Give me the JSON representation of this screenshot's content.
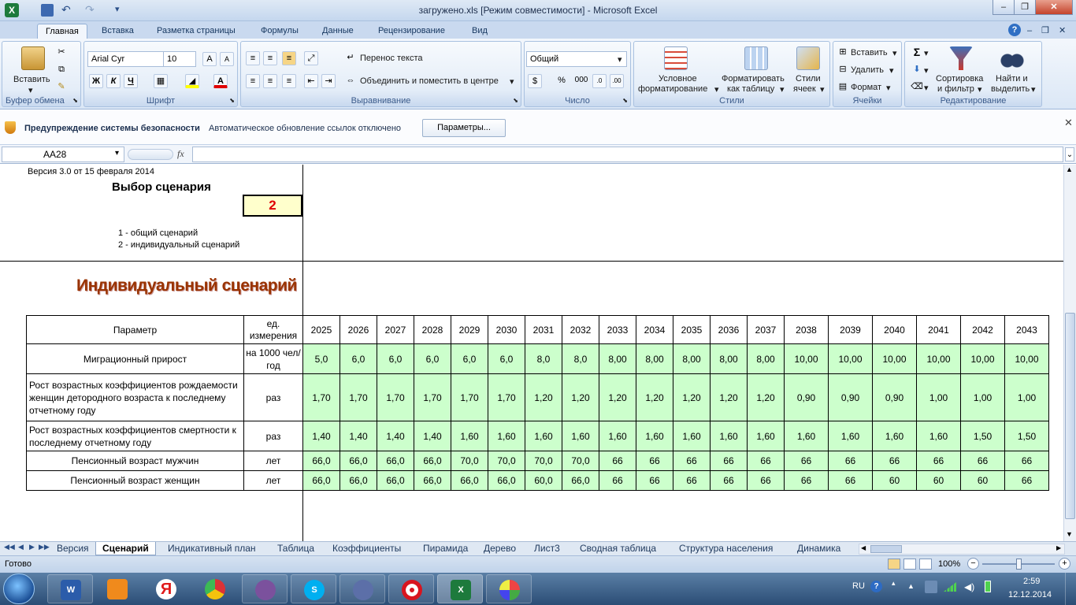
{
  "window": {
    "title": "загружено.xls  [Режим совместимости] - Microsoft Excel"
  },
  "ribbon_tabs": [
    "Главная",
    "Вставка",
    "Разметка страницы",
    "Формулы",
    "Данные",
    "Рецензирование",
    "Вид"
  ],
  "ribbon": {
    "clipboard": {
      "paste": "Вставить",
      "label": "Буфер обмена"
    },
    "font": {
      "name": "Arial Cyr",
      "size": "10",
      "bold": "Ж",
      "italic": "К",
      "underline": "Ч",
      "label": "Шрифт"
    },
    "alignment": {
      "wrap": "Перенос текста",
      "merge": "Объединить и поместить в центре",
      "label": "Выравнивание"
    },
    "number": {
      "format": "Общий",
      "percent": "%",
      "thousands": "000",
      "label": "Число"
    },
    "styles": {
      "conditional_1": "Условное",
      "conditional_2": "форматирование",
      "table_1": "Форматировать",
      "table_2": "как таблицу",
      "cell_1": "Стили",
      "cell_2": "ячеек",
      "label": "Стили"
    },
    "cells": {
      "insert": "Вставить",
      "delete": "Удалить",
      "format": "Формат",
      "label": "Ячейки"
    },
    "editing": {
      "sort_1": "Сортировка",
      "sort_2": "и фильтр",
      "find_1": "Найти и",
      "find_2": "выделить",
      "label": "Редактирование"
    }
  },
  "security_bar": {
    "title": "Предупреждение системы безопасности",
    "message": "Автоматическое обновление ссылок отключено",
    "button": "Параметры..."
  },
  "formula_bar": {
    "name_box": "AA28",
    "fx": "fx",
    "value": ""
  },
  "sheet": {
    "version": "Версия 3.0 от 15 февраля 2014",
    "choose_title": "Выбор сценария",
    "scenario_value": "2",
    "option1": "1 - общий сценарий",
    "option2": "2 - индивидуальный сценарий",
    "big_title": "Индивидуальный сценарий",
    "table": {
      "header_param": "Параметр",
      "header_unit_1": "ед.",
      "header_unit_2": "измерения",
      "years": [
        "2025",
        "2026",
        "2027",
        "2028",
        "2029",
        "2030",
        "2031",
        "2032",
        "2033",
        "2034",
        "2035",
        "2036",
        "2037",
        "2038",
        "2039",
        "2040",
        "2041",
        "2042",
        "2043"
      ],
      "rows": [
        {
          "param": "Миграционный прирост",
          "unit": "на 1000 чел/год",
          "values": [
            "5,0",
            "6,0",
            "6,0",
            "6,0",
            "6,0",
            "6,0",
            "8,0",
            "8,0",
            "8,00",
            "8,00",
            "8,00",
            "8,00",
            "8,00",
            "10,00",
            "10,00",
            "10,00",
            "10,00",
            "10,00",
            "10,00"
          ]
        },
        {
          "param": "Рост возрастных коэффициентов рождаемости женщин детородного возраста к последнему отчетному году",
          "unit": "раз",
          "values": [
            "1,70",
            "1,70",
            "1,70",
            "1,70",
            "1,70",
            "1,70",
            "1,20",
            "1,20",
            "1,20",
            "1,20",
            "1,20",
            "1,20",
            "1,20",
            "0,90",
            "0,90",
            "0,90",
            "1,00",
            "1,00",
            "1,00"
          ]
        },
        {
          "param": "Рост возрастных коэффициентов смертности к последнему отчетному году",
          "unit": "раз",
          "values": [
            "1,40",
            "1,40",
            "1,40",
            "1,40",
            "1,60",
            "1,60",
            "1,60",
            "1,60",
            "1,60",
            "1,60",
            "1,60",
            "1,60",
            "1,60",
            "1,60",
            "1,60",
            "1,60",
            "1,60",
            "1,50",
            "1,50"
          ]
        },
        {
          "param": "Пенсионный возраст мужчин",
          "unit": "лет",
          "values": [
            "66,0",
            "66,0",
            "66,0",
            "66,0",
            "70,0",
            "70,0",
            "70,0",
            "70,0",
            "66",
            "66",
            "66",
            "66",
            "66",
            "66",
            "66",
            "66",
            "66",
            "66",
            "66"
          ]
        },
        {
          "param": "Пенсионный возраст женщин",
          "unit": "лет",
          "values": [
            "66,0",
            "66,0",
            "66,0",
            "66,0",
            "66,0",
            "66,0",
            "60,0",
            "66,0",
            "66",
            "66",
            "66",
            "66",
            "66",
            "66",
            "66",
            "60",
            "60",
            "60",
            "66"
          ]
        }
      ]
    }
  },
  "sheet_tabs": [
    "Версия",
    "Сценарий",
    "Индикативный план",
    "Таблица",
    "Коэффициенты",
    "Пирамида",
    "Дерево",
    "Лист3",
    "Сводная таблица",
    "Структура населения",
    "Динамика на"
  ],
  "active_sheet": "Сценарий",
  "status": {
    "ready": "Готово",
    "zoom": "100%"
  },
  "taskbar": {
    "lang": "RU",
    "time": "2:59",
    "date": "12.12.2014"
  },
  "colors": {
    "accent": "#1e5aa8",
    "green_cell": "#ccffcc",
    "yellow_cell": "#ffffcc",
    "title_brown": "#993300"
  }
}
